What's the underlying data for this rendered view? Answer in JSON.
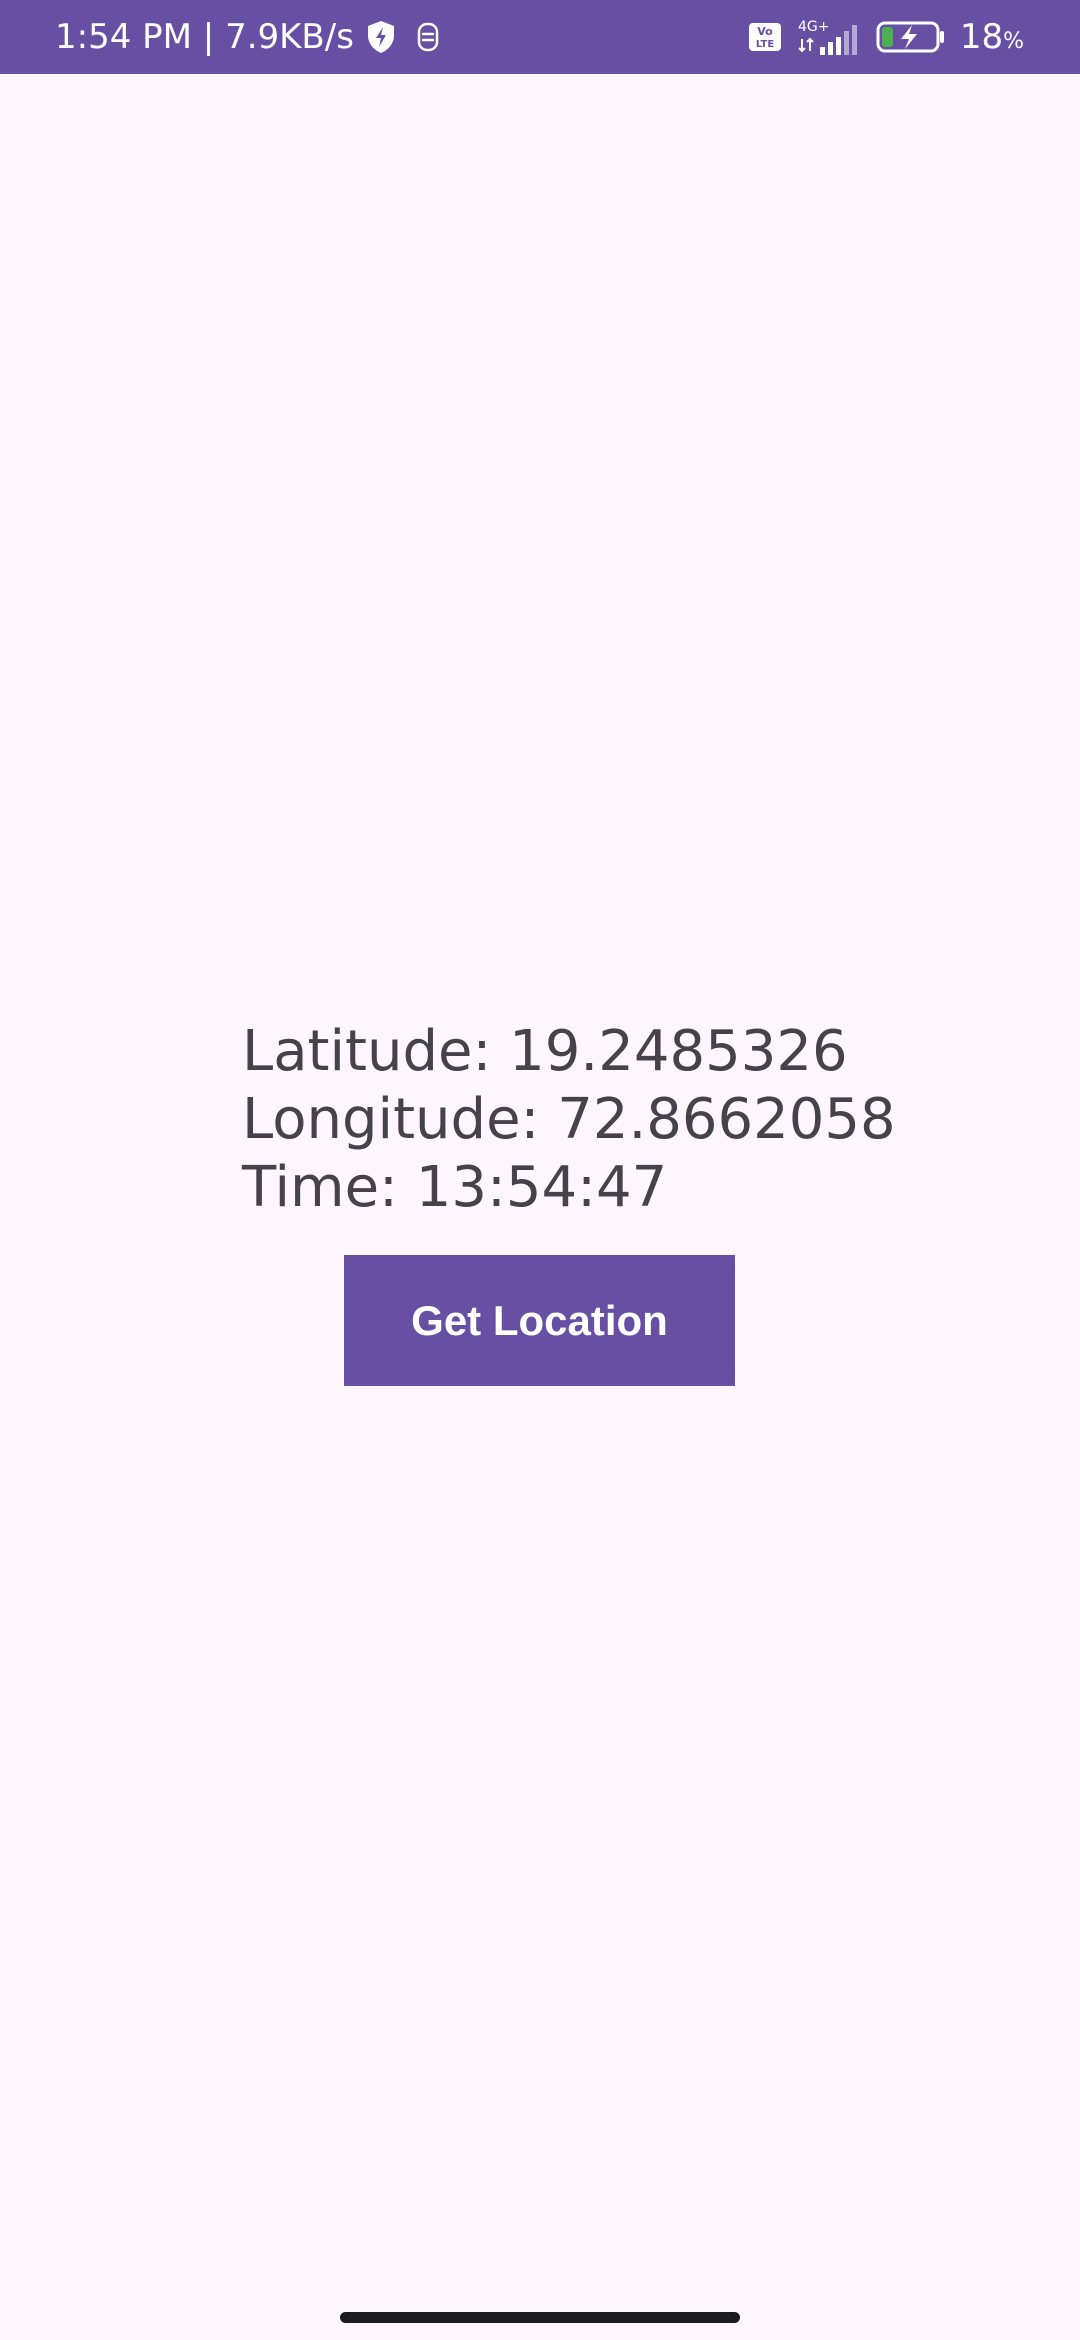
{
  "status_bar": {
    "time_speed": "1:54 PM | 7.9KB/s",
    "network_type": "4G+",
    "volte": "Vo LTE",
    "battery_value": "18",
    "battery_unit": "%",
    "icons": [
      "shield-bolt-icon",
      "notification-icon",
      "volte-icon",
      "signal-icon",
      "battery-charging-icon"
    ],
    "background_color": "#6750a4"
  },
  "location": {
    "latitude_text": "Latitude: 19.2485326",
    "longitude_text": "Longitude: 72.8662058",
    "time_text": "Time: 13:54:47"
  },
  "actions": {
    "get_location_label": "Get Location"
  },
  "colors": {
    "accent": "#6750a4",
    "background": "#fdf7fd",
    "text": "#45424a"
  }
}
